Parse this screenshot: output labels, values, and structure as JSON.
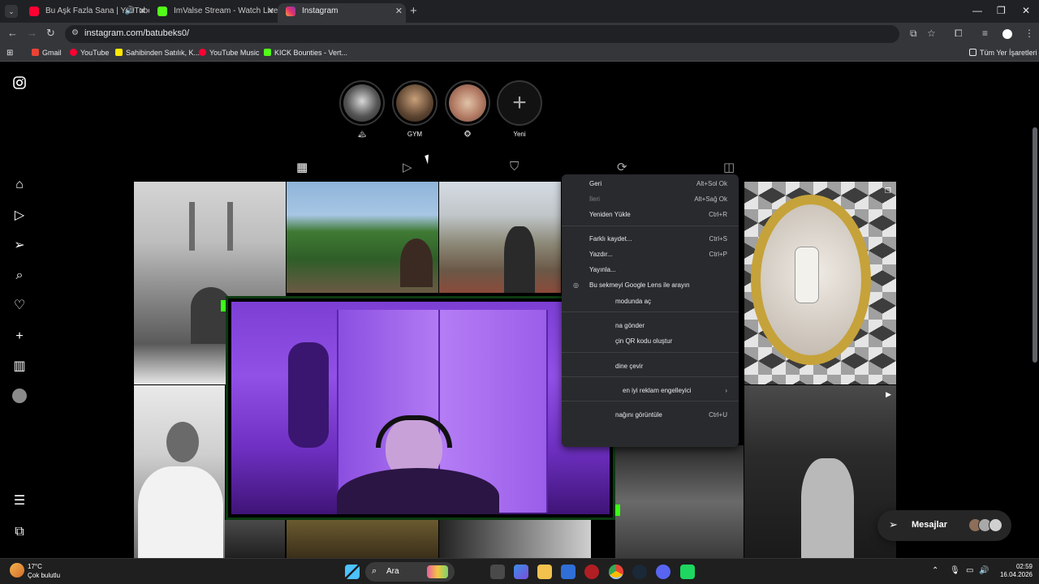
{
  "browser": {
    "tabs": [
      {
        "title": "Bu Aşk Fazla Sana | YouTube",
        "favicon_color": "#ff0033"
      },
      {
        "title": "ImValse Stream - Watch Live on",
        "favicon_color": "#53fc18"
      },
      {
        "title": "Instagram",
        "favicon_color": "#e1306c"
      }
    ],
    "url": "instagram.com/batubeks0/"
  },
  "bookmarks": [
    {
      "label": "Gmail",
      "color": "#ea4335"
    },
    {
      "label": "YouTube",
      "color": "#ff0033"
    },
    {
      "label": "Sahibinden Satılık, K...",
      "color": "#ffe800"
    },
    {
      "label": "YouTube Music",
      "color": "#ff0033"
    },
    {
      "label": "KICK Bounties - Vert...",
      "color": "#53fc18"
    }
  ],
  "bookmarks_all": "Tüm Yer İşaretleri",
  "highlights": [
    {
      "label": "🏔"
    },
    {
      "label": "GYM"
    },
    {
      "label": "🐵"
    },
    {
      "label": "Yeni"
    }
  ],
  "context_menu": {
    "items": [
      {
        "label": "Geri",
        "shortcut": "Alt+Sol Ok"
      },
      {
        "label": "İleri",
        "shortcut": "Alt+Sağ Ok"
      },
      {
        "label": "Yeniden Yükle",
        "shortcut": "Ctrl+R"
      },
      {
        "label": "Farklı kaydet...",
        "shortcut": "Ctrl+S"
      },
      {
        "label": "Yazdır...",
        "shortcut": "Ctrl+P"
      },
      {
        "label": "Yayınla..."
      },
      {
        "label": "Bu sekmeyi Google Lens ile arayın"
      },
      {
        "label": "modunda aç"
      },
      {
        "label": "na gönder"
      },
      {
        "label": "çin QR kodu oluştur"
      },
      {
        "label": "dine çevir"
      },
      {
        "label": "en iyi reklam engelleyici"
      },
      {
        "label": "nağını görüntüle",
        "shortcut": "Ctrl+U"
      }
    ]
  },
  "messages_label": "Mesajlar",
  "taskbar": {
    "temp": "17°C",
    "weather": "Çok bulutlu",
    "search": "Ara",
    "time": "02:59",
    "date": "16.04.2026"
  }
}
